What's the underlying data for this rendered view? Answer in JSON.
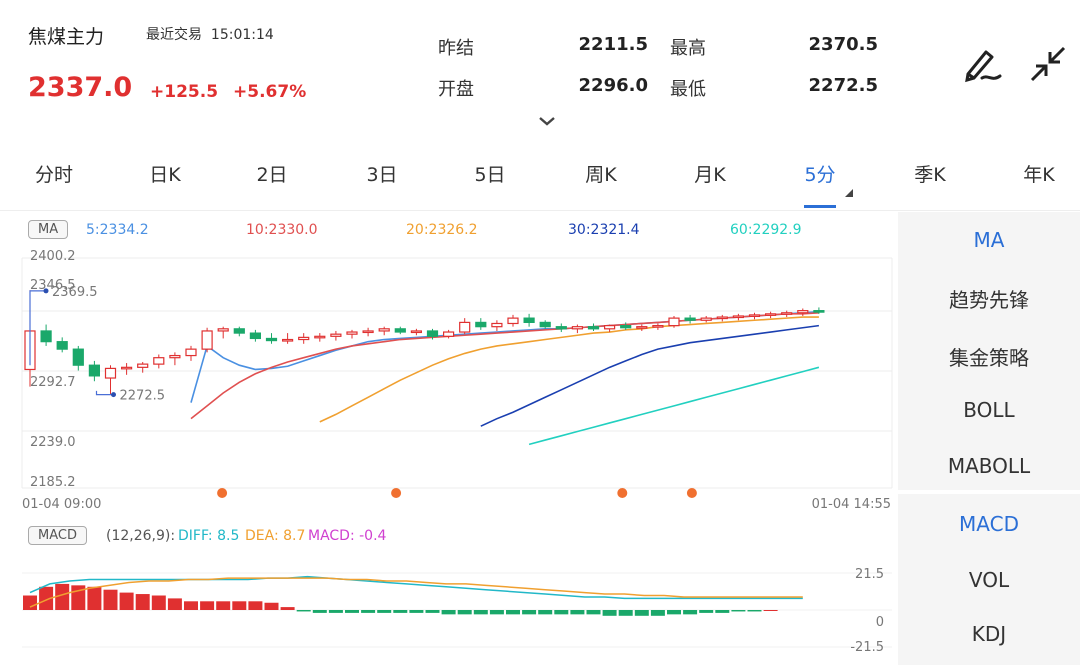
{
  "header": {
    "name": "焦煤主力",
    "last_trade_label": "最近交易",
    "last_trade_time": "15:01:14",
    "price": "2337.0",
    "change": "+125.5",
    "change_pct": "+5.67%"
  },
  "quote": {
    "prev_settle_label": "昨结",
    "prev_settle": "2211.5",
    "open_label": "开盘",
    "open": "2296.0",
    "high_label": "最高",
    "high": "2370.5",
    "low_label": "最低",
    "low": "2272.5"
  },
  "tabs": [
    "分时",
    "日K",
    "2日",
    "3日",
    "5日",
    "周K",
    "月K",
    "5分",
    "季K",
    "年K"
  ],
  "active_tab": "5分",
  "ma_legend": {
    "tag": "MA",
    "ma5": "5:2334.2",
    "ma10": "10:2330.0",
    "ma20": "20:2326.2",
    "ma30": "30:2321.4",
    "ma60": "60:2292.9"
  },
  "price_axis": [
    "2400.2",
    "2346.5",
    "2292.7",
    "2239.0",
    "2185.2"
  ],
  "annotations": {
    "high": "2369.5",
    "low": "2272.5"
  },
  "time_axis": {
    "start": "01-04 09:00",
    "end": "01-04 14:55"
  },
  "macd_legend": {
    "tag": "MACD",
    "params": "(12,26,9):",
    "diff": "DIFF: 8.5",
    "dea": "DEA: 8.7",
    "macd": "MACD: -0.4"
  },
  "macd_axis": [
    "21.5",
    "0",
    "-21.5"
  ],
  "side_main": [
    "MA",
    "趋势先锋",
    "集金策略",
    "BOLL",
    "MABOLL"
  ],
  "side_sub": [
    "MACD",
    "VOL",
    "KDJ"
  ],
  "colors": {
    "up": "#e03030",
    "down": "#1aa86a",
    "ma5": "#4a90e2",
    "ma10": "#e05050",
    "ma20": "#f0a030",
    "ma30": "#1a3fb0",
    "ma60": "#22d0c0",
    "accent": "#2b6fd6",
    "event_dot": "#f07030"
  },
  "chart_data": {
    "type": "candlestick",
    "price_range": [
      2185.2,
      2400.2
    ],
    "candles": [
      {
        "o": 2296,
        "h": 2370,
        "l": 2280,
        "c": 2332
      },
      {
        "o": 2332,
        "h": 2338,
        "l": 2318,
        "c": 2322
      },
      {
        "o": 2322,
        "h": 2326,
        "l": 2312,
        "c": 2315
      },
      {
        "o": 2315,
        "h": 2318,
        "l": 2295,
        "c": 2300
      },
      {
        "o": 2300,
        "h": 2304,
        "l": 2285,
        "c": 2290
      },
      {
        "o": 2288,
        "h": 2300,
        "l": 2273,
        "c": 2297
      },
      {
        "o": 2297,
        "h": 2302,
        "l": 2291,
        "c": 2298
      },
      {
        "o": 2298,
        "h": 2303,
        "l": 2293,
        "c": 2301
      },
      {
        "o": 2301,
        "h": 2310,
        "l": 2297,
        "c": 2307
      },
      {
        "o": 2307,
        "h": 2312,
        "l": 2300,
        "c": 2309
      },
      {
        "o": 2309,
        "h": 2318,
        "l": 2304,
        "c": 2315
      },
      {
        "o": 2315,
        "h": 2335,
        "l": 2312,
        "c": 2332
      },
      {
        "o": 2332,
        "h": 2336,
        "l": 2325,
        "c": 2334
      },
      {
        "o": 2334,
        "h": 2336,
        "l": 2327,
        "c": 2330
      },
      {
        "o": 2330,
        "h": 2333,
        "l": 2322,
        "c": 2325
      },
      {
        "o": 2325,
        "h": 2330,
        "l": 2320,
        "c": 2323
      },
      {
        "o": 2323,
        "h": 2330,
        "l": 2320,
        "c": 2324
      },
      {
        "o": 2324,
        "h": 2330,
        "l": 2320,
        "c": 2326
      },
      {
        "o": 2326,
        "h": 2330,
        "l": 2322,
        "c": 2327
      },
      {
        "o": 2327,
        "h": 2332,
        "l": 2323,
        "c": 2329
      },
      {
        "o": 2329,
        "h": 2333,
        "l": 2325,
        "c": 2331
      },
      {
        "o": 2331,
        "h": 2335,
        "l": 2327,
        "c": 2332
      },
      {
        "o": 2332,
        "h": 2336,
        "l": 2328,
        "c": 2334
      },
      {
        "o": 2334,
        "h": 2336,
        "l": 2329,
        "c": 2331
      },
      {
        "o": 2331,
        "h": 2334,
        "l": 2328,
        "c": 2332
      },
      {
        "o": 2332,
        "h": 2334,
        "l": 2324,
        "c": 2327
      },
      {
        "o": 2327,
        "h": 2333,
        "l": 2325,
        "c": 2331
      },
      {
        "o": 2331,
        "h": 2344,
        "l": 2329,
        "c": 2340
      },
      {
        "o": 2340,
        "h": 2344,
        "l": 2333,
        "c": 2336
      },
      {
        "o": 2336,
        "h": 2342,
        "l": 2332,
        "c": 2339
      },
      {
        "o": 2339,
        "h": 2347,
        "l": 2336,
        "c": 2344
      },
      {
        "o": 2344,
        "h": 2348,
        "l": 2336,
        "c": 2340
      },
      {
        "o": 2340,
        "h": 2342,
        "l": 2334,
        "c": 2336
      },
      {
        "o": 2336,
        "h": 2339,
        "l": 2331,
        "c": 2334
      },
      {
        "o": 2334,
        "h": 2338,
        "l": 2330,
        "c": 2336
      },
      {
        "o": 2336,
        "h": 2339,
        "l": 2332,
        "c": 2334
      },
      {
        "o": 2334,
        "h": 2338,
        "l": 2331,
        "c": 2337
      },
      {
        "o": 2337,
        "h": 2340,
        "l": 2333,
        "c": 2335
      },
      {
        "o": 2335,
        "h": 2338,
        "l": 2332,
        "c": 2336
      },
      {
        "o": 2336,
        "h": 2339,
        "l": 2333,
        "c": 2337
      },
      {
        "o": 2337,
        "h": 2346,
        "l": 2335,
        "c": 2344
      },
      {
        "o": 2344,
        "h": 2347,
        "l": 2339,
        "c": 2342
      },
      {
        "o": 2342,
        "h": 2346,
        "l": 2340,
        "c": 2344
      },
      {
        "o": 2344,
        "h": 2347,
        "l": 2341,
        "c": 2345
      },
      {
        "o": 2345,
        "h": 2348,
        "l": 2342,
        "c": 2346
      },
      {
        "o": 2346,
        "h": 2349,
        "l": 2343,
        "c": 2347
      },
      {
        "o": 2347,
        "h": 2350,
        "l": 2344,
        "c": 2348
      },
      {
        "o": 2348,
        "h": 2351,
        "l": 2345,
        "c": 2349
      },
      {
        "o": 2349,
        "h": 2353,
        "l": 2346,
        "c": 2351
      },
      {
        "o": 2351,
        "h": 2354,
        "l": 2348,
        "c": 2350
      }
    ],
    "ma_series": [
      {
        "name": "5",
        "color": "#4a90e2",
        "values": [
          2265,
          2318,
          2307,
          2300,
          2296,
          2297,
          2299,
          2304,
          2309,
          2314,
          2318,
          2322,
          2324,
          2325,
          2326,
          2327,
          2328,
          2329,
          2330,
          2331,
          2332,
          2333,
          2334,
          2334,
          2335,
          2336,
          2337,
          2338,
          2339,
          2340,
          2341,
          2342,
          2343,
          2344,
          2345,
          2346,
          2347,
          2348,
          2349,
          2350
        ]
      },
      {
        "name": "10",
        "color": "#e05050",
        "values": [
          2250,
          2262,
          2274,
          2284,
          2292,
          2298,
          2303,
          2307,
          2311,
          2315,
          2318,
          2320,
          2322,
          2324,
          2325,
          2326,
          2327,
          2328,
          2329,
          2330,
          2331,
          2332,
          2333,
          2334,
          2335,
          2336,
          2337,
          2338,
          2339,
          2340,
          2341,
          2342,
          2343,
          2344,
          2345,
          2346,
          2347,
          2348,
          2348,
          2349
        ]
      },
      {
        "name": "20",
        "color": "#f0a030",
        "values": [
          2247,
          2254,
          2262,
          2270,
          2278,
          2286,
          2293,
          2300,
          2306,
          2311,
          2315,
          2318,
          2320,
          2322,
          2324,
          2326,
          2328,
          2330,
          2331,
          2333,
          2334,
          2336,
          2337,
          2338,
          2339,
          2340,
          2341,
          2342,
          2343,
          2344,
          2345,
          2345
        ]
      },
      {
        "name": "30",
        "color": "#1a3fb0",
        "values": [
          2243,
          2250,
          2256,
          2263,
          2270,
          2277,
          2284,
          2291,
          2298,
          2304,
          2310,
          2315,
          2318,
          2321,
          2323,
          2325,
          2327,
          2329,
          2331,
          2333,
          2335,
          2337
        ]
      },
      {
        "name": "60",
        "color": "#22d0c0",
        "values": [
          2226,
          2230,
          2234,
          2238,
          2242,
          2246,
          2250,
          2254,
          2258,
          2262,
          2266,
          2270,
          2274,
          2278,
          2282,
          2286,
          2290,
          2294,
          2298
        ]
      }
    ],
    "macd": {
      "range": [
        -21.5,
        21.5
      ],
      "bars": [
        10,
        16,
        18,
        17,
        16,
        14,
        12,
        11,
        10,
        8,
        6,
        6,
        6,
        6,
        6,
        5,
        2,
        -1,
        -2,
        -2,
        -2,
        -2,
        -2,
        -2,
        -2,
        -2,
        -3,
        -3,
        -3,
        -3,
        -3,
        -3,
        -3,
        -3,
        -3,
        -3,
        -4,
        -4,
        -4,
        -4,
        -3,
        -3,
        -2,
        -2,
        -1,
        -1,
        0
      ],
      "diff": [
        12,
        18,
        20,
        21,
        21,
        21,
        21,
        21,
        21,
        21,
        21,
        21,
        22,
        22,
        23,
        22,
        21,
        20,
        19,
        18,
        17,
        16,
        15,
        14,
        13,
        12,
        11,
        10,
        9,
        9,
        8,
        8,
        8,
        8,
        8,
        8,
        8,
        8,
        8,
        8
      ],
      "dea": [
        2,
        8,
        12,
        15,
        17,
        19,
        20,
        20,
        21,
        21,
        22,
        22,
        22,
        22,
        22,
        22,
        21,
        21,
        20,
        20,
        19,
        18,
        18,
        17,
        16,
        15,
        14,
        13,
        12,
        11,
        11,
        10,
        10,
        9,
        9,
        9,
        9,
        9,
        9,
        9
      ]
    },
    "event_markers_pct": [
      0.23,
      0.43,
      0.69,
      0.77
    ]
  }
}
